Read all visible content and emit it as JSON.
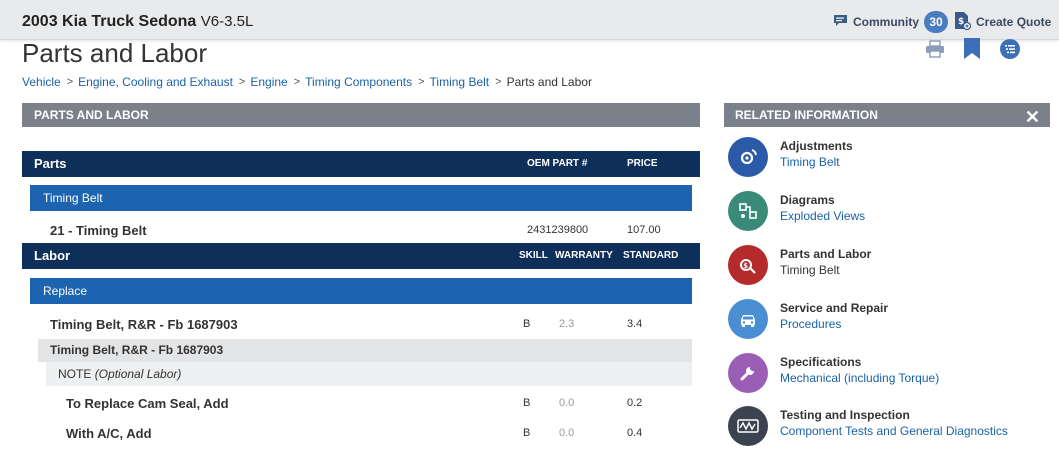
{
  "header": {
    "vehicle": "2003 Kia Truck Sedona",
    "engine": "V6-3.5L",
    "community_label": "Community",
    "community_count": "30",
    "create_quote_label": "Create Quote"
  },
  "page_title": "Parts and Labor",
  "breadcrumb": [
    "Vehicle",
    "Engine, Cooling and Exhaust",
    "Engine",
    "Timing Components",
    "Timing Belt",
    "Parts and Labor"
  ],
  "section_title": "PARTS AND LABOR",
  "parts": {
    "header": "Parts",
    "col_oem": "OEM PART #",
    "col_price": "PRICE",
    "group": "Timing Belt",
    "items": [
      {
        "name": "21 - Timing Belt",
        "oem": "2431239800",
        "price": "107.00"
      }
    ]
  },
  "labor": {
    "header": "Labor",
    "col_skill": "SKILL",
    "col_warranty": "WARRANTY",
    "col_standard": "STANDARD",
    "group": "Replace",
    "main_item": {
      "name": "Timing Belt, R&R - Fb 1687903",
      "skill": "B",
      "warranty": "2.3",
      "standard": "3.4"
    },
    "sub_header": "Timing Belt, R&R - Fb 1687903",
    "note_label": "NOTE",
    "note_text": "(Optional Labor)",
    "optional_items": [
      {
        "name": "To Replace Cam Seal, Add",
        "skill": "B",
        "warranty": "0.0",
        "standard": "0.2"
      },
      {
        "name": "With A/C, Add",
        "skill": "B",
        "warranty": "0.0",
        "standard": "0.4"
      }
    ]
  },
  "related": {
    "title": "RELATED INFORMATION",
    "close_glyph": "✕",
    "items": [
      {
        "title": "Adjustments",
        "link": "Timing Belt",
        "icon": "adjustments-icon",
        "color": "#2b5aa8",
        "linked": true
      },
      {
        "title": "Diagrams",
        "link": "Exploded Views",
        "icon": "diagrams-icon",
        "color": "#3a8a78",
        "linked": true
      },
      {
        "title": "Parts and Labor",
        "link": "Timing Belt",
        "icon": "parts-labor-icon",
        "color": "#b52a2a",
        "linked": false
      },
      {
        "title": "Service and Repair",
        "link": "Procedures",
        "icon": "service-repair-icon",
        "color": "#4a8fd4",
        "linked": true
      },
      {
        "title": "Specifications",
        "link": "Mechanical (including Torque)",
        "icon": "specifications-icon",
        "color": "#9a5fb5",
        "linked": true
      },
      {
        "title": "Testing and Inspection",
        "link": "Component Tests and General Diagnostics",
        "icon": "testing-icon",
        "color": "#3c4350",
        "linked": true
      }
    ]
  },
  "colors": {
    "dark_header": "#0d2f5a",
    "blue_bar": "#1c63b0",
    "section_grey": "#7b818a",
    "link": "#1a62a8"
  }
}
